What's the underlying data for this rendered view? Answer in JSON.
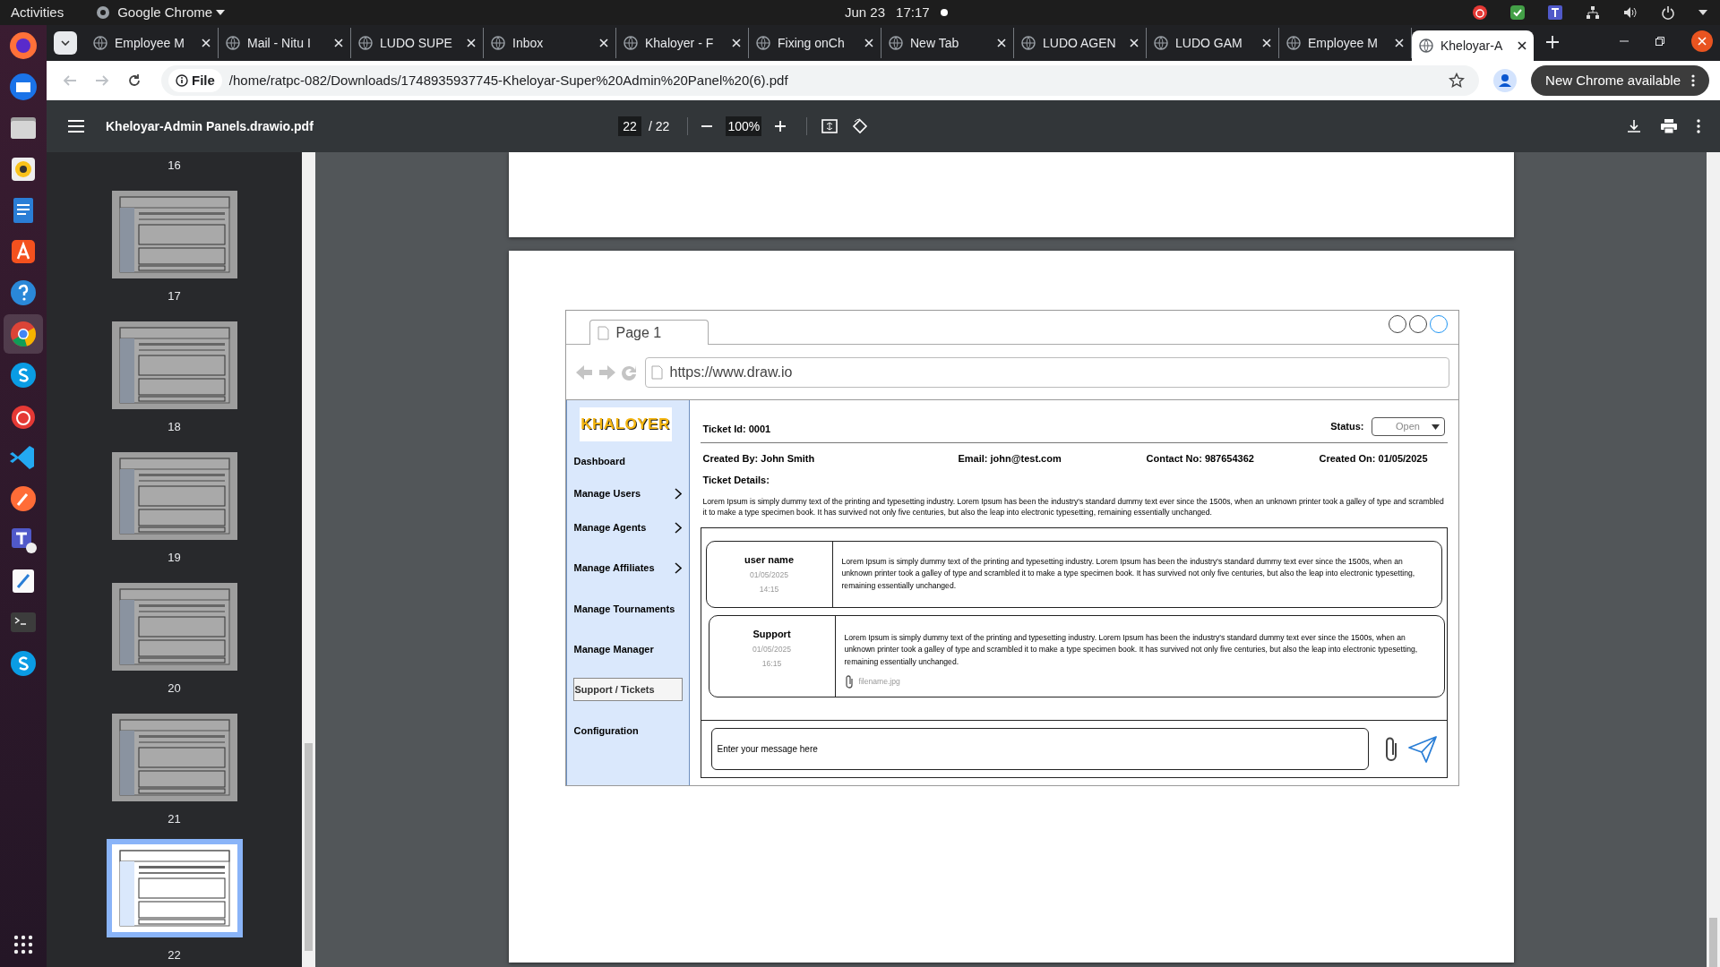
{
  "top_bar": {
    "activities": "Activities",
    "app_name": "Google Chrome",
    "date": "Jun 23",
    "time": "17:17"
  },
  "tabs": [
    {
      "title": "Employee M",
      "selected": false
    },
    {
      "title": "Mail - Nitu I",
      "selected": false
    },
    {
      "title": "LUDO SUPE",
      "selected": false
    },
    {
      "title": "Inbox",
      "selected": false
    },
    {
      "title": "Khaloyer - F",
      "selected": false
    },
    {
      "title": "Fixing onCh",
      "selected": false
    },
    {
      "title": "New Tab",
      "selected": false
    },
    {
      "title": "LUDO AGEN",
      "selected": false
    },
    {
      "title": "LUDO GAM",
      "selected": false
    },
    {
      "title": "Employee M",
      "selected": false
    },
    {
      "title": "Kheloyar-A",
      "selected": true
    }
  ],
  "address_bar": {
    "scheme": "File",
    "url": "/home/ratpc-082/Downloads/1748935937745-Kheloyar-Super%20Admin%20Panel%20(6).pdf"
  },
  "update_button": "New Chrome available",
  "pdf_toolbar": {
    "title": "Kheloyar-Admin Panels.drawio.pdf",
    "page": "22",
    "total": "/ 22",
    "zoom": "100%"
  },
  "thumbnails": [
    {
      "label": "16",
      "selected": false
    },
    {
      "label": "17",
      "selected": false
    },
    {
      "label": "18",
      "selected": false
    },
    {
      "label": "19",
      "selected": false
    },
    {
      "label": "20",
      "selected": false
    },
    {
      "label": "21",
      "selected": false
    },
    {
      "label": "22",
      "selected": true
    }
  ],
  "mockup": {
    "tab": "Page 1",
    "url": "https://www.draw.io",
    "logo": "KHALOYER",
    "menu": [
      {
        "label": "Dashboard",
        "submenu": false,
        "selected": false
      },
      {
        "label": "Manage Users",
        "submenu": true,
        "selected": false
      },
      {
        "label": "Manage Agents",
        "submenu": true,
        "selected": false
      },
      {
        "label": "Manage Affiliates",
        "submenu": true,
        "selected": false
      },
      {
        "label": "Manage Tournaments",
        "submenu": false,
        "selected": false
      },
      {
        "label": "Manage Manager",
        "submenu": false,
        "selected": false
      },
      {
        "label": "Support / Tickets",
        "submenu": false,
        "selected": true
      },
      {
        "label": "Configuration",
        "submenu": false,
        "selected": false
      }
    ],
    "ticket_id": "Ticket Id: 0001",
    "status_label": "Status:",
    "status": "Open",
    "info": [
      "Created By: John Smith",
      "Email: john@test.com",
      "Contact No: 987654362",
      "Created On: 01/05/2025"
    ],
    "details_label": "Ticket Details:",
    "details": "Lorem Ipsum is simply dummy text of the printing and typesetting industry. Lorem Ipsum has been the industry's standard dummy text ever since the 1500s, when an unknown printer took a galley of type and scrambled it to make a type specimen book. It has survived not only five centuries, but also the leap into electronic typesetting, remaining essentially unchanged.",
    "messages": [
      {
        "sender": "user name",
        "date": "01/05/2025",
        "time": "14:15",
        "text": "Lorem Ipsum is simply dummy text of the printing and typesetting industry. Lorem Ipsum has been the industry's standard dummy text ever since the 1500s, when an unknown printer took a galley of type and scrambled it to make a type specimen book. It has survived not only five centuries, but also the leap into electronic typesetting, remaining essentially unchanged."
      },
      {
        "sender": "Support",
        "date": "01/05/2025",
        "time": "16:15",
        "text": "Lorem Ipsum is simply dummy text of the printing and typesetting industry. Lorem Ipsum has been the industry's standard dummy text ever since the 1500s, when an unknown printer took a galley of type and scrambled it to make a type specimen book. It has survived not only five centuries, but also the leap into electronic typesetting, remaining essentially unchanged.",
        "attachment": "filename.jpg"
      }
    ],
    "message_placeholder": "Enter your message here"
  }
}
